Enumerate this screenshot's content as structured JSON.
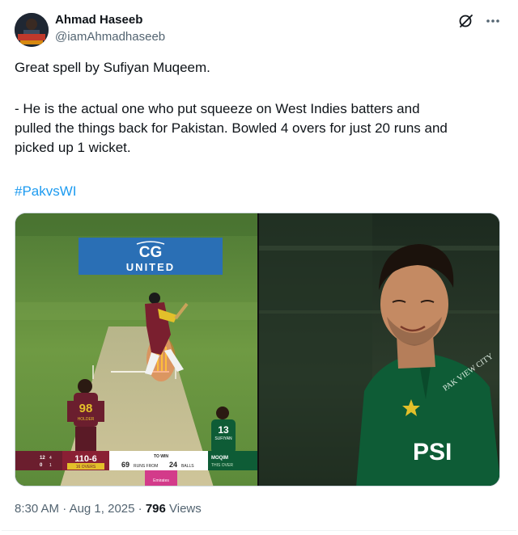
{
  "author": {
    "name": "Ahmad Haseeb",
    "handle": "@iamAhmadhaseeb"
  },
  "header_icons": [
    "grok-icon",
    "more-icon"
  ],
  "tweet": {
    "line1": "Great spell by Sufiyan Muqeem.",
    "para2_line1": "- He is the actual one who put squeeze on West Indies batters and",
    "para2_line2": "pulled the things back for Pakistan. Bowled 4 overs for just 20 runs and",
    "para2_line3": "picked up 1 wicket.",
    "hashtag": "#PakvsWI"
  },
  "media": {
    "left": {
      "board_brand": "CG",
      "board_text": "UNITED",
      "batter_number": "98",
      "batter_name": "HOLDER",
      "fielder_number": "13",
      "fielder_name": "SUFIYAN",
      "scorebug": {
        "batter1_score": "12",
        "batter1_balls": "4",
        "batter2_score": "0",
        "batter2_balls": "1",
        "team_score": "110-6",
        "overs": "16 OVERS",
        "to_win_label": "TO WIN",
        "runs_needed": "69",
        "runs_label": "RUNS FROM",
        "balls_left": "24",
        "balls_label": "BALLS",
        "bowler": "MOQIM",
        "bowler_figures": "THIS OVER"
      },
      "umpire_text": "Emirates"
    },
    "right": {
      "jersey_text": "PSI",
      "sponsor_text": "PAK VIEW CITY"
    }
  },
  "meta": {
    "time": "8:30 AM",
    "sep1": " · ",
    "date": "Aug 1, 2025",
    "sep2": " · ",
    "views": "796",
    "views_label": " Views"
  },
  "colors": {
    "text": "#0f1419",
    "secondary": "#536471",
    "link": "#1d9bf0",
    "pakistan_green": "#0e5c36",
    "windies_maroon": "#6b1e2e"
  }
}
